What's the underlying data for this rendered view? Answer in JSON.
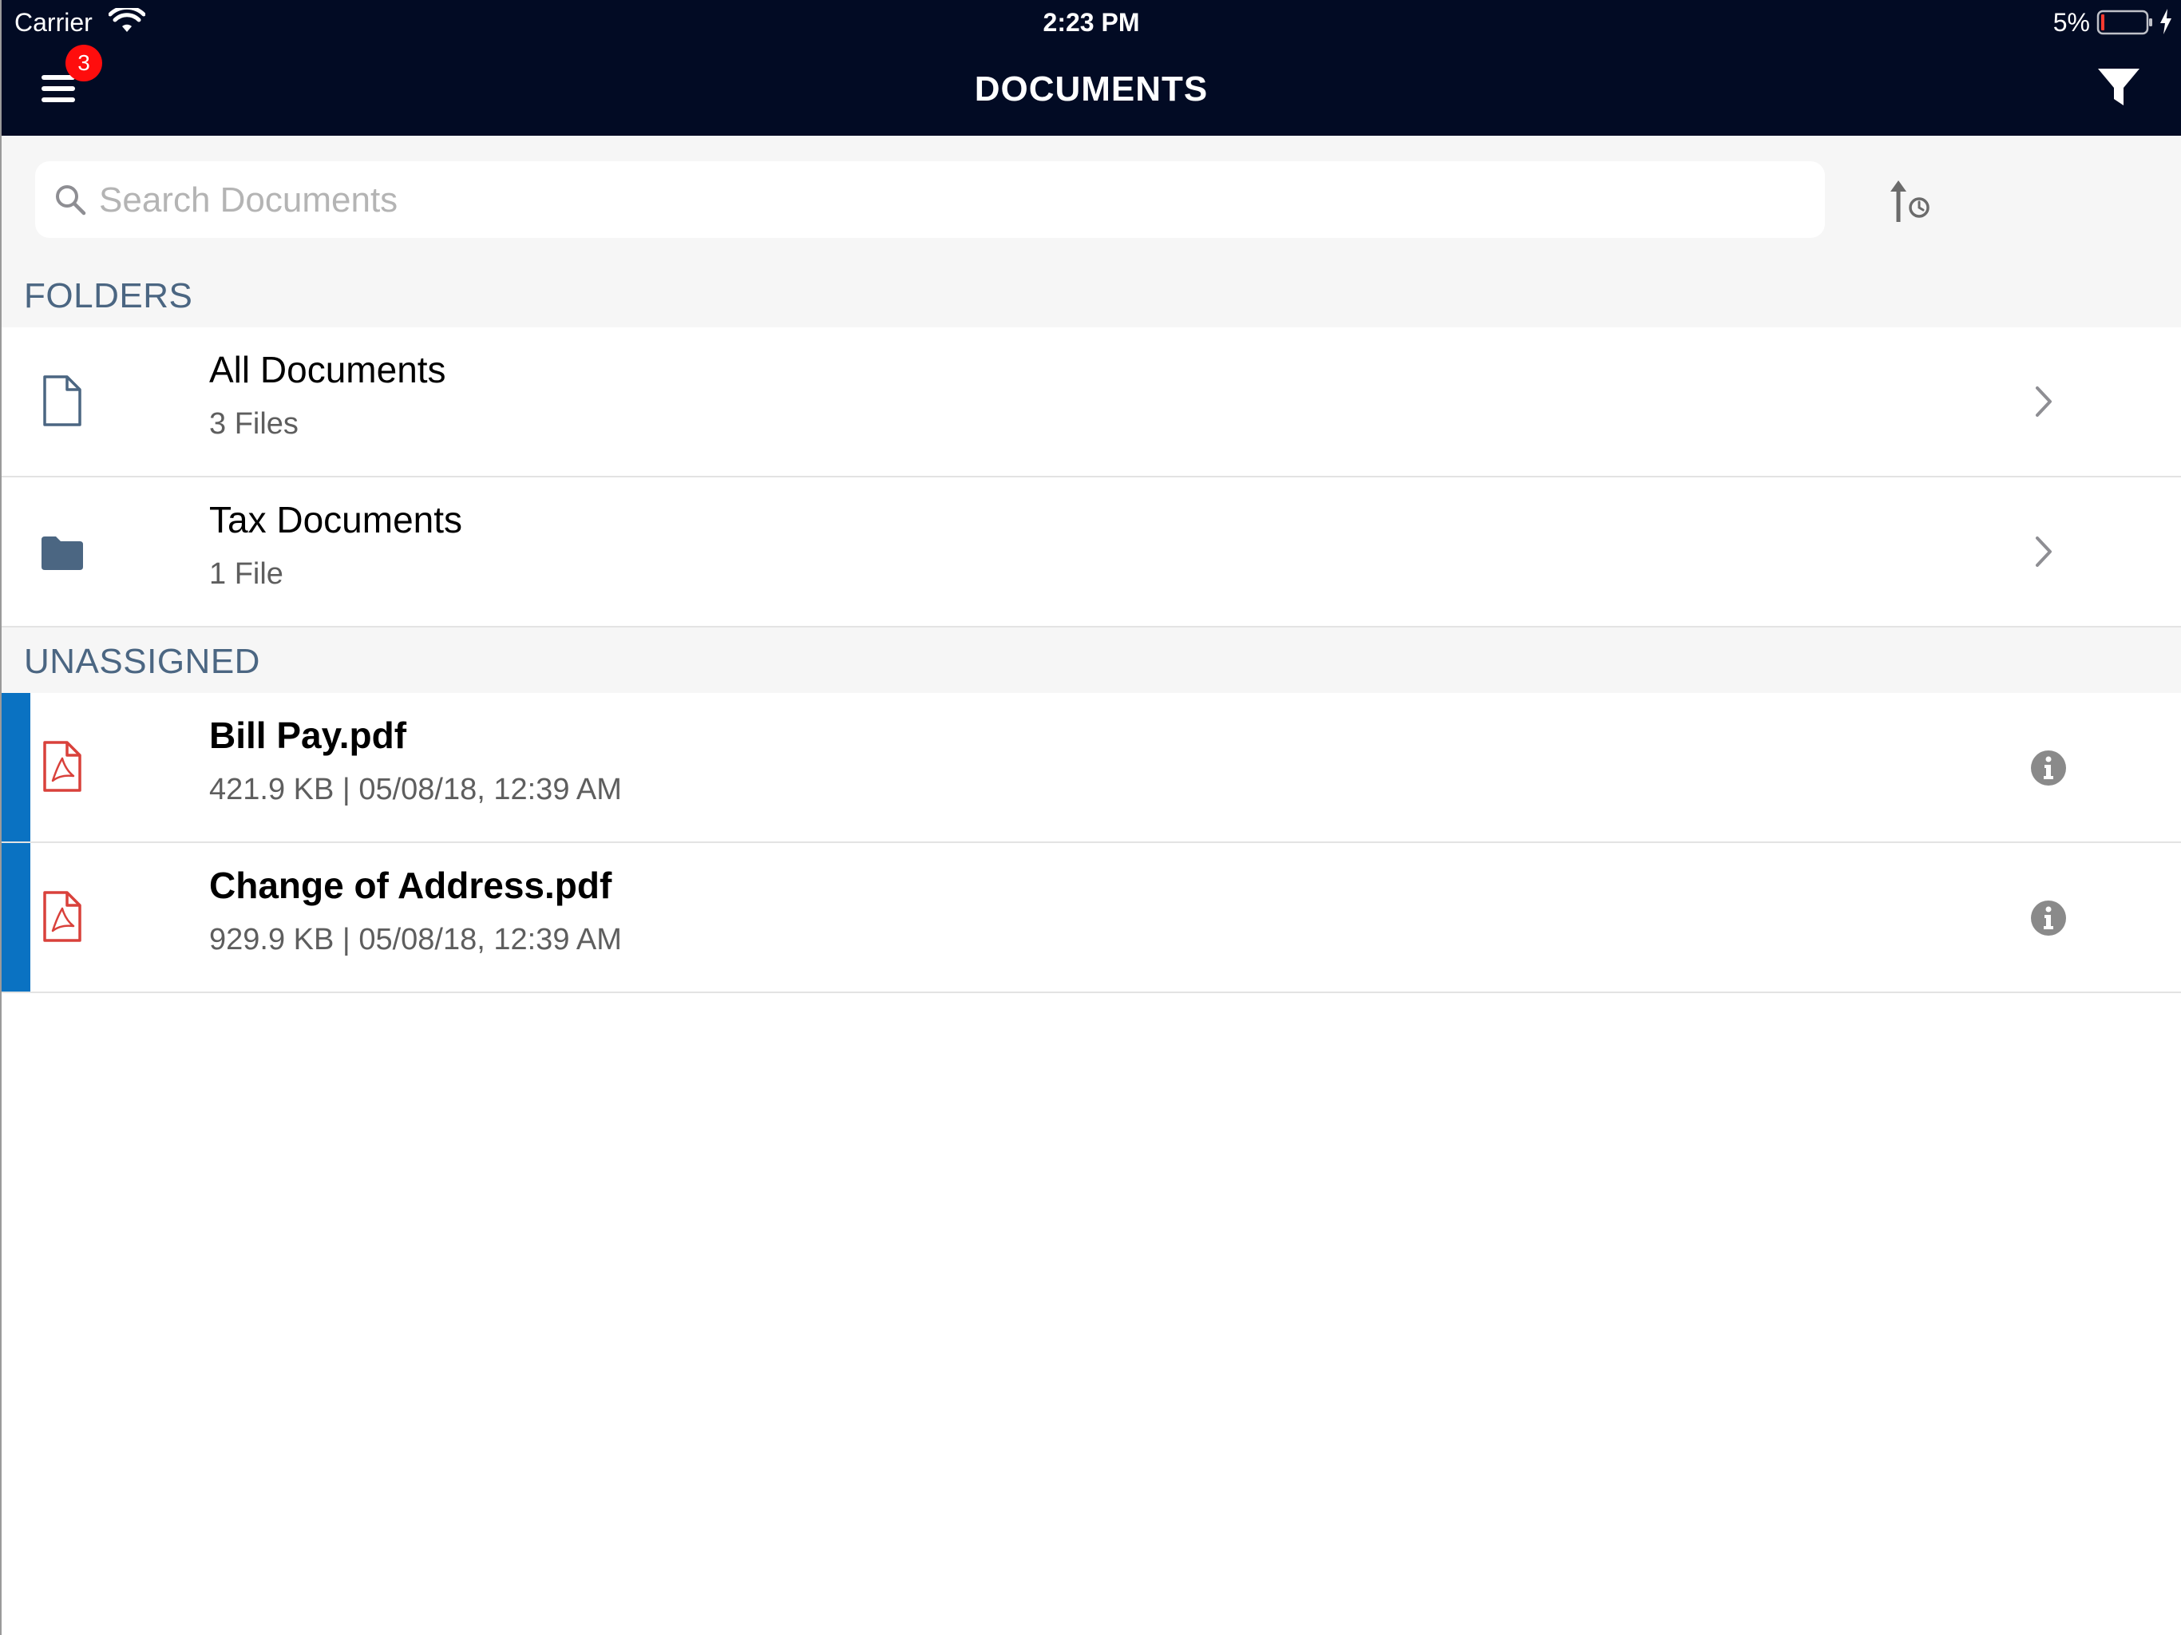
{
  "status_bar": {
    "carrier": "Carrier",
    "time": "2:23 PM",
    "battery_percent": "5%"
  },
  "nav": {
    "title": "DOCUMENTS",
    "menu_badge_count": "3",
    "background_color": "#020b24"
  },
  "search": {
    "placeholder": "Search Documents",
    "value": ""
  },
  "folders_section": {
    "header": "FOLDERS",
    "items": [
      {
        "title": "All Documents",
        "subtitle": "3 Files",
        "icon": "document-outline-icon"
      },
      {
        "title": "Tax Documents",
        "subtitle": "1 File",
        "icon": "folder-icon"
      }
    ]
  },
  "unassigned_section": {
    "header": "UNASSIGNED",
    "items": [
      {
        "title": "Bill Pay.pdf",
        "subtitle": "421.9 KB | 05/08/18, 12:39 AM",
        "icon": "pdf-icon",
        "unread": true
      },
      {
        "title": "Change of Address.pdf",
        "subtitle": "929.9 KB | 05/08/18, 12:39 AM",
        "icon": "pdf-icon",
        "unread": true
      }
    ]
  },
  "colors": {
    "accent_blue": "#0a72c2",
    "section_header": "#4b6682",
    "badge_red": "#ff0d0d",
    "pdf_red": "#d9413b"
  }
}
